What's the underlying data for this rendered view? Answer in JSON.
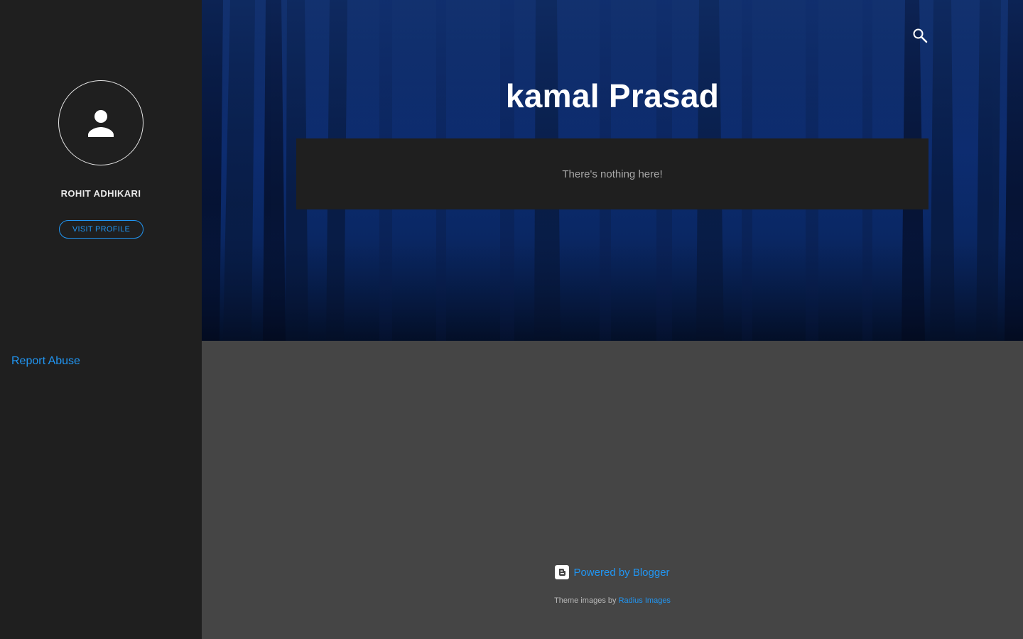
{
  "sidebar": {
    "profile_name": "ROHIT ADHIKARI",
    "visit_profile_label": "VISIT PROFILE",
    "report_abuse_label": "Report Abuse"
  },
  "header": {
    "blog_title": "kamal Prasad",
    "search_icon": "search-icon"
  },
  "main": {
    "empty_message": "There's nothing here!"
  },
  "footer": {
    "powered_by_label": "Powered by Blogger",
    "theme_images_prefix": "Theme images by",
    "theme_images_link": "Radius Images"
  },
  "colors": {
    "sidebar_bg": "#1f1f1f",
    "page_bg": "#454545",
    "link": "#2196f3",
    "header_blue": "#0c2a6b"
  }
}
